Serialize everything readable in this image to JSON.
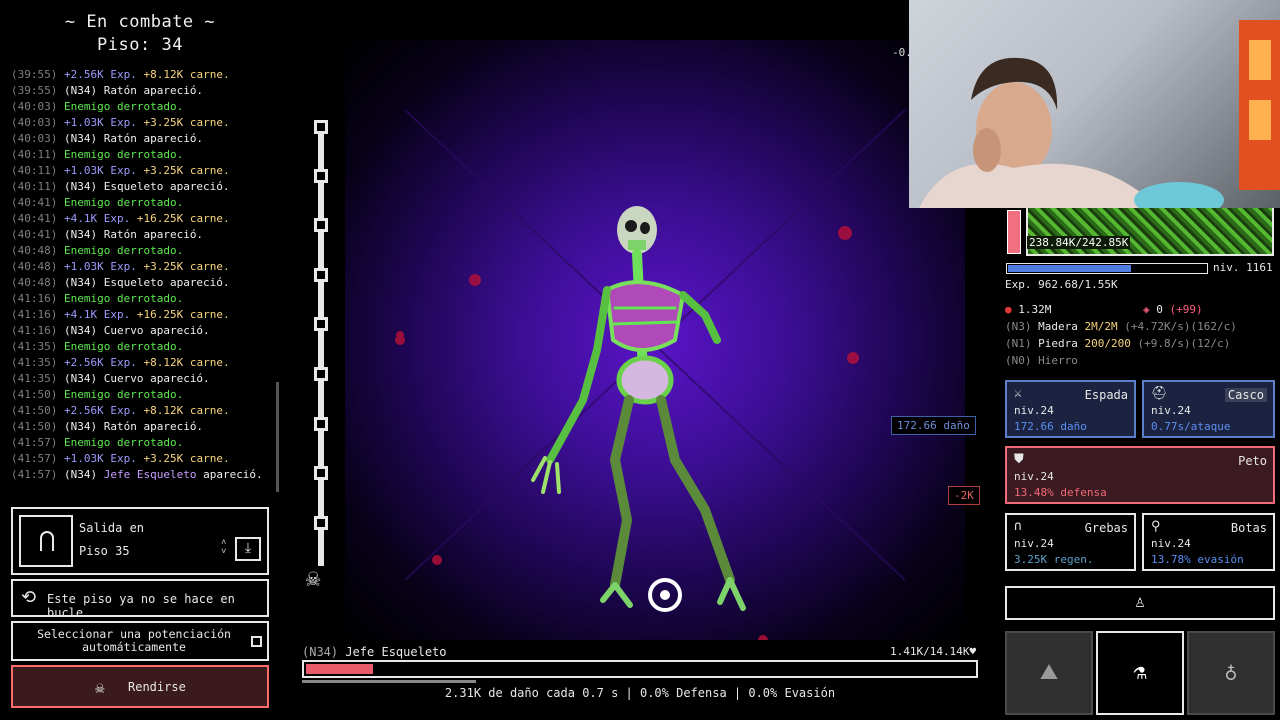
{
  "header": {
    "title": "~ En combate ~",
    "floor": "Piso: 34"
  },
  "log": [
    {
      "time": "(39:55)",
      "parts": [
        {
          "text": "+2.56K",
          "c": "c-exp"
        },
        {
          "text": " Exp. ",
          "c": "c-exp"
        },
        {
          "text": "+8.12K carne.",
          "c": "c-carne"
        }
      ]
    },
    {
      "time": "(39:55)",
      "parts": [
        {
          "text": "(N34) Ratón apareció.",
          "c": "c-white"
        }
      ]
    },
    {
      "time": "(40:03)",
      "parts": [
        {
          "text": "Enemigo derrotado.",
          "c": "c-green"
        }
      ]
    },
    {
      "time": "(40:03)",
      "parts": [
        {
          "text": "+1.03K",
          "c": "c-exp"
        },
        {
          "text": " Exp. ",
          "c": "c-exp"
        },
        {
          "text": "+3.25K carne.",
          "c": "c-carne"
        }
      ]
    },
    {
      "time": "(40:03)",
      "parts": [
        {
          "text": "(N34) Ratón apareció.",
          "c": "c-white"
        }
      ]
    },
    {
      "time": "(40:11)",
      "parts": [
        {
          "text": "Enemigo derrotado.",
          "c": "c-green"
        }
      ]
    },
    {
      "time": "(40:11)",
      "parts": [
        {
          "text": "+1.03K",
          "c": "c-exp"
        },
        {
          "text": " Exp. ",
          "c": "c-exp"
        },
        {
          "text": "+3.25K carne.",
          "c": "c-carne"
        }
      ]
    },
    {
      "time": "(40:11)",
      "parts": [
        {
          "text": "(N34) Esqueleto apareció.",
          "c": "c-white"
        }
      ]
    },
    {
      "time": "(40:41)",
      "parts": [
        {
          "text": "Enemigo derrotado.",
          "c": "c-green"
        }
      ]
    },
    {
      "time": "(40:41)",
      "parts": [
        {
          "text": "+4.1K",
          "c": "c-exp"
        },
        {
          "text": " Exp. ",
          "c": "c-exp"
        },
        {
          "text": "+16.25K carne.",
          "c": "c-carne"
        }
      ]
    },
    {
      "time": "(40:41)",
      "parts": [
        {
          "text": "(N34) Ratón apareció.",
          "c": "c-white"
        }
      ]
    },
    {
      "time": "(40:48)",
      "parts": [
        {
          "text": "Enemigo derrotado.",
          "c": "c-green"
        }
      ]
    },
    {
      "time": "(40:48)",
      "parts": [
        {
          "text": "+1.03K",
          "c": "c-exp"
        },
        {
          "text": " Exp. ",
          "c": "c-exp"
        },
        {
          "text": "+3.25K carne.",
          "c": "c-carne"
        }
      ]
    },
    {
      "time": "(40:48)",
      "parts": [
        {
          "text": "(N34) Esqueleto apareció.",
          "c": "c-white"
        }
      ]
    },
    {
      "time": "(41:16)",
      "parts": [
        {
          "text": "Enemigo derrotado.",
          "c": "c-green"
        }
      ]
    },
    {
      "time": "(41:16)",
      "parts": [
        {
          "text": "+4.1K",
          "c": "c-exp"
        },
        {
          "text": " Exp. ",
          "c": "c-exp"
        },
        {
          "text": "+16.25K carne.",
          "c": "c-carne"
        }
      ]
    },
    {
      "time": "(41:16)",
      "parts": [
        {
          "text": "(N34) Cuervo apareció.",
          "c": "c-white"
        }
      ]
    },
    {
      "time": "(41:35)",
      "parts": [
        {
          "text": "Enemigo derrotado.",
          "c": "c-green"
        }
      ]
    },
    {
      "time": "(41:35)",
      "parts": [
        {
          "text": "+2.56K",
          "c": "c-exp"
        },
        {
          "text": " Exp. ",
          "c": "c-exp"
        },
        {
          "text": "+8.12K carne.",
          "c": "c-carne"
        }
      ]
    },
    {
      "time": "(41:35)",
      "parts": [
        {
          "text": "(N34) Cuervo apareció.",
          "c": "c-white"
        }
      ]
    },
    {
      "time": "(41:50)",
      "parts": [
        {
          "text": "Enemigo derrotado.",
          "c": "c-green"
        }
      ]
    },
    {
      "time": "(41:50)",
      "parts": [
        {
          "text": "+2.56K",
          "c": "c-exp"
        },
        {
          "text": " Exp. ",
          "c": "c-exp"
        },
        {
          "text": "+8.12K carne.",
          "c": "c-carne"
        }
      ]
    },
    {
      "time": "(41:50)",
      "parts": [
        {
          "text": "(N34) Ratón apareció.",
          "c": "c-white"
        }
      ]
    },
    {
      "time": "(41:57)",
      "parts": [
        {
          "text": "Enemigo derrotado.",
          "c": "c-green"
        }
      ]
    },
    {
      "time": "(41:57)",
      "parts": [
        {
          "text": "+1.03K",
          "c": "c-exp"
        },
        {
          "text": " Exp. ",
          "c": "c-exp"
        },
        {
          "text": "+3.25K carne.",
          "c": "c-carne"
        }
      ]
    },
    {
      "time": "(41:57)",
      "parts": [
        {
          "text": "(N34) ",
          "c": "c-white"
        },
        {
          "text": "Jefe Esqueleto",
          "c": "c-boss"
        },
        {
          "text": " apareció.",
          "c": "c-white"
        }
      ]
    }
  ],
  "exit": {
    "line1": "Salida en",
    "line2": "Piso 35",
    "stepper": "^\nv",
    "down": "⤓"
  },
  "loop": {
    "icon": "⟲",
    "label": "Este piso ya no se hace en bucle"
  },
  "auto": {
    "label": "Seleccionar una potenciación automáticamente"
  },
  "surrender": {
    "icon": "☠",
    "label": "Rendirse"
  },
  "track": {
    "skull": "☠"
  },
  "floaters": {
    "stray": "-0.",
    "damage_tip": "172.66 daño",
    "damage_tip2": "-2K"
  },
  "enemy": {
    "level": "(N34)",
    "name": "Jefe Esqueleto",
    "hp": "1.41K/14.14K♥",
    "hp_fraction": 0.1,
    "stats": "2.31K de daño cada 0.7 s | 0.0% Defensa | 0.0% Evasión"
  },
  "monster_thumb": {
    "hp": "238.84K/242.85K"
  },
  "player": {
    "level": "niv. 1161",
    "exp": "Exp. 962.68/1.55K",
    "xp_fraction": 0.62
  },
  "resources": {
    "meat": "1.32M",
    "gems": "0",
    "gems_bonus": "(+99)",
    "wood_tier": "(N3)",
    "wood_name": "Madera",
    "wood_amount": "2M/2M",
    "wood_rate": "(+4.72K/s)(162/c)",
    "stone_tier": "(N1)",
    "stone_name": "Piedra",
    "stone_amount": "200/200",
    "stone_rate": "(+9.8/s)(12/c)",
    "iron": "(N0) Hierro"
  },
  "equipment": {
    "sword": {
      "icon": "⚔",
      "name": "Espada",
      "level": "niv.24",
      "stat": "172.66 daño"
    },
    "helmet": {
      "icon": "⛑",
      "name": "Casco",
      "level": "niv.24",
      "stat": "0.77s/ataque"
    },
    "chest": {
      "icon": "⛊",
      "name": "Peto",
      "level": "niv.24",
      "stat": "13.48% defensa"
    },
    "legs": {
      "icon": "∩",
      "name": "Grebas",
      "level": "niv.24",
      "stat": "3.25K regen."
    },
    "boots": {
      "icon": "⚲",
      "name": "Botas",
      "level": "niv.24",
      "stat": "13.78% evasión"
    }
  },
  "action_bar": {
    "icon": "♙"
  },
  "slots": {
    "map": "⛰",
    "potion": "⚗",
    "bomb": "♁"
  },
  "colors": {
    "accent_blue": "#5b7fc8",
    "accent_pink": "#f06a78",
    "hp": "#e95a6a",
    "scene": "#3d0e95"
  }
}
